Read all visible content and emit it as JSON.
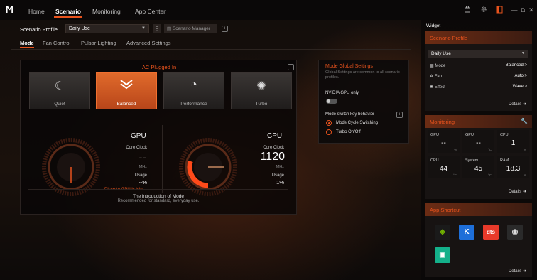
{
  "app": {
    "logo": "Ϻ"
  },
  "nav": {
    "home": "Home",
    "scenario": "Scenario",
    "monitoring": "Monitoring",
    "app_center": "App Center"
  },
  "topicons": {
    "icons": [
      "bag-icon",
      "gear-icon",
      "sidebar-icon",
      "minimize-icon",
      "restore-icon",
      "close-icon"
    ],
    "min": "—",
    "restore": "⧉",
    "close": "✕"
  },
  "profile": {
    "label": "Scenario Profile",
    "value": "Daily Use",
    "manager": "Scenario Manager"
  },
  "subtabs": [
    "Mode",
    "Fan Control",
    "Pulsar Lighting",
    "Advanced Settings"
  ],
  "panel": {
    "title": "AC Plugged In",
    "modes": [
      {
        "label": "Quiet",
        "icon": "quiet-icon"
      },
      {
        "label": "Balanced",
        "icon": "balanced-icon"
      },
      {
        "label": "Performance",
        "icon": "performance-icon"
      },
      {
        "label": "Turbo",
        "icon": "turbo-icon"
      }
    ],
    "selected_mode": "Balanced",
    "gpu": {
      "name": "GPU",
      "clock_label": "Core Clock",
      "clock": "--",
      "unit": "MHz",
      "usage_label": "Usage",
      "usage": "--%",
      "note": "Discrete GPU is idle"
    },
    "cpu": {
      "name": "CPU",
      "clock_label": "Core Clock",
      "clock": "1120",
      "unit": "MHz",
      "usage_label": "Usage",
      "usage": "1%",
      "gauge_fraction": 0.3
    },
    "intro_title": "The introduction of Mode",
    "intro_desc": "Recommended for standard, everyday use."
  },
  "global": {
    "title": "Mode Global Settings",
    "desc": "Global Settings are common to all scenario profiles.",
    "nvidia_label": "NVIDIA GPU only",
    "nvidia_on": false,
    "switch_label": "Mode switch key behavior",
    "options": [
      "Mode Cycle Switching",
      "Turbo On/Off"
    ],
    "selected": "Mode Cycle Switching"
  },
  "widget": {
    "title": "Widget",
    "scenario": {
      "title": "Scenario Profile",
      "value": "Daily Use",
      "rows": [
        {
          "label": "Mode",
          "value": "Balanced >"
        },
        {
          "label": "Fan",
          "value": "Auto >"
        },
        {
          "label": "Effect",
          "value": "Wave >"
        }
      ],
      "details": "Details ➜"
    },
    "monitoring": {
      "title": "Monitoring",
      "cells": [
        {
          "name": "GPU",
          "value": "--",
          "unit": "%"
        },
        {
          "name": "GPU",
          "value": "--",
          "unit": "°C"
        },
        {
          "name": "CPU",
          "value": "1",
          "unit": "%"
        },
        {
          "name": "CPU",
          "value": "44",
          "unit": "°C"
        },
        {
          "name": "System",
          "value": "45",
          "unit": "°C"
        },
        {
          "name": "RAM",
          "value": "18.3",
          "unit": "%"
        }
      ],
      "details": "Details ➜"
    },
    "shortcuts": {
      "title": "App Shortcut",
      "apps": [
        {
          "name": "nvidia-icon",
          "text": "◈",
          "bg": "#1a1a1a",
          "fg": "#76b900"
        },
        {
          "name": "k-app-icon",
          "text": "K",
          "bg": "#1e6fd9",
          "fg": "#ffffff"
        },
        {
          "name": "dts-icon",
          "text": "dts",
          "bg": "#e83a2a",
          "fg": "#ffffff"
        },
        {
          "name": "disc-app-icon",
          "text": "◉",
          "bg": "#2a2a2a",
          "fg": "#dddddd"
        },
        {
          "name": "predator-sense-icon",
          "text": "▣",
          "bg": "#14b08a",
          "fg": "#ffffff"
        }
      ],
      "details": "Details ➜"
    }
  }
}
